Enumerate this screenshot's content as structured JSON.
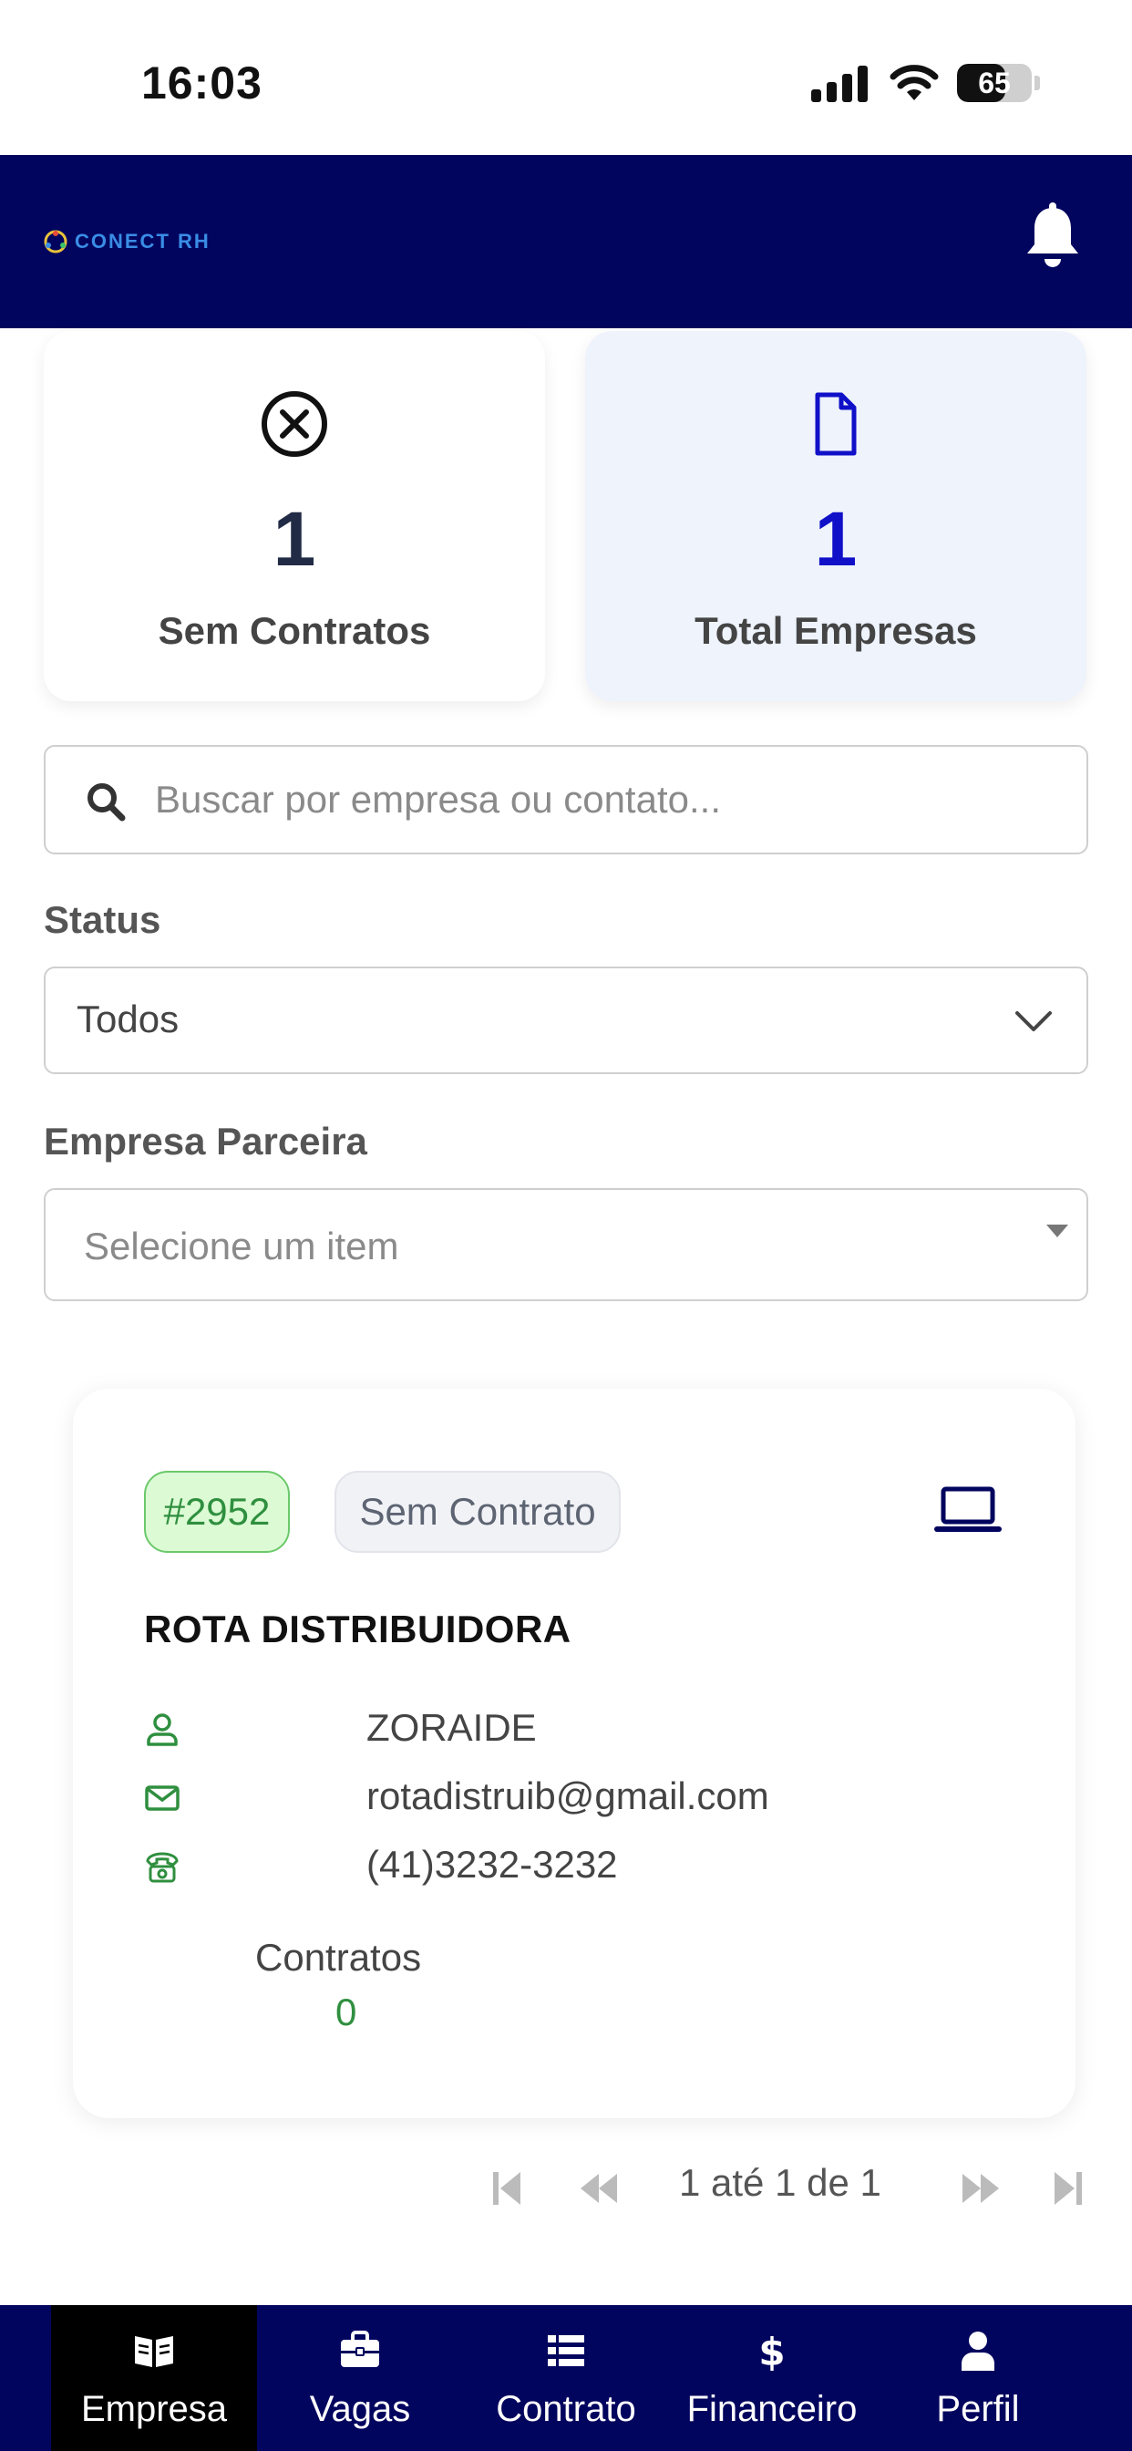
{
  "status_bar": {
    "time": "16:03",
    "battery": "65",
    "battery_level": 0.65
  },
  "header": {
    "logo_text": "CONECT RH",
    "icons": [
      "logo-icon",
      "bell-icon"
    ]
  },
  "stats": [
    {
      "value": "1",
      "label": "Sem Contratos",
      "icon": "x-circle-icon",
      "color": "#222b45"
    },
    {
      "value": "1",
      "label": "Total Empresas",
      "icon": "file-icon",
      "color": "#1010c8"
    }
  ],
  "search": {
    "placeholder": "Buscar por empresa ou contato..."
  },
  "filters": {
    "status_label": "Status",
    "status_value": "Todos",
    "partner_label": "Empresa Parceira",
    "partner_placeholder": "Selecione um item"
  },
  "companies": [
    {
      "id": "#2952",
      "status": "Sem Contrato",
      "name": "ROTA DISTRIBUIDORA",
      "contact": "ZORAIDE",
      "email": "rotadistruib@gmail.com",
      "phone": "(41)3232-3232",
      "contracts_label": "Contratos",
      "contracts_count": "0"
    }
  ],
  "pagination": {
    "text": "1 até 1 de 1"
  },
  "bottom_nav": [
    {
      "label": "Empresa",
      "icon": "book-icon",
      "active": true
    },
    {
      "label": "Vagas",
      "icon": "briefcase-icon",
      "active": false
    },
    {
      "label": "Contrato",
      "icon": "list-icon",
      "active": false
    },
    {
      "label": "Financeiro",
      "icon": "dollar-icon",
      "active": false
    },
    {
      "label": "Perfil",
      "icon": "user-icon",
      "active": false
    }
  ],
  "colors": {
    "primary": "#02055e",
    "accent_blue": "#1010c8",
    "green": "#2f8f3f"
  }
}
